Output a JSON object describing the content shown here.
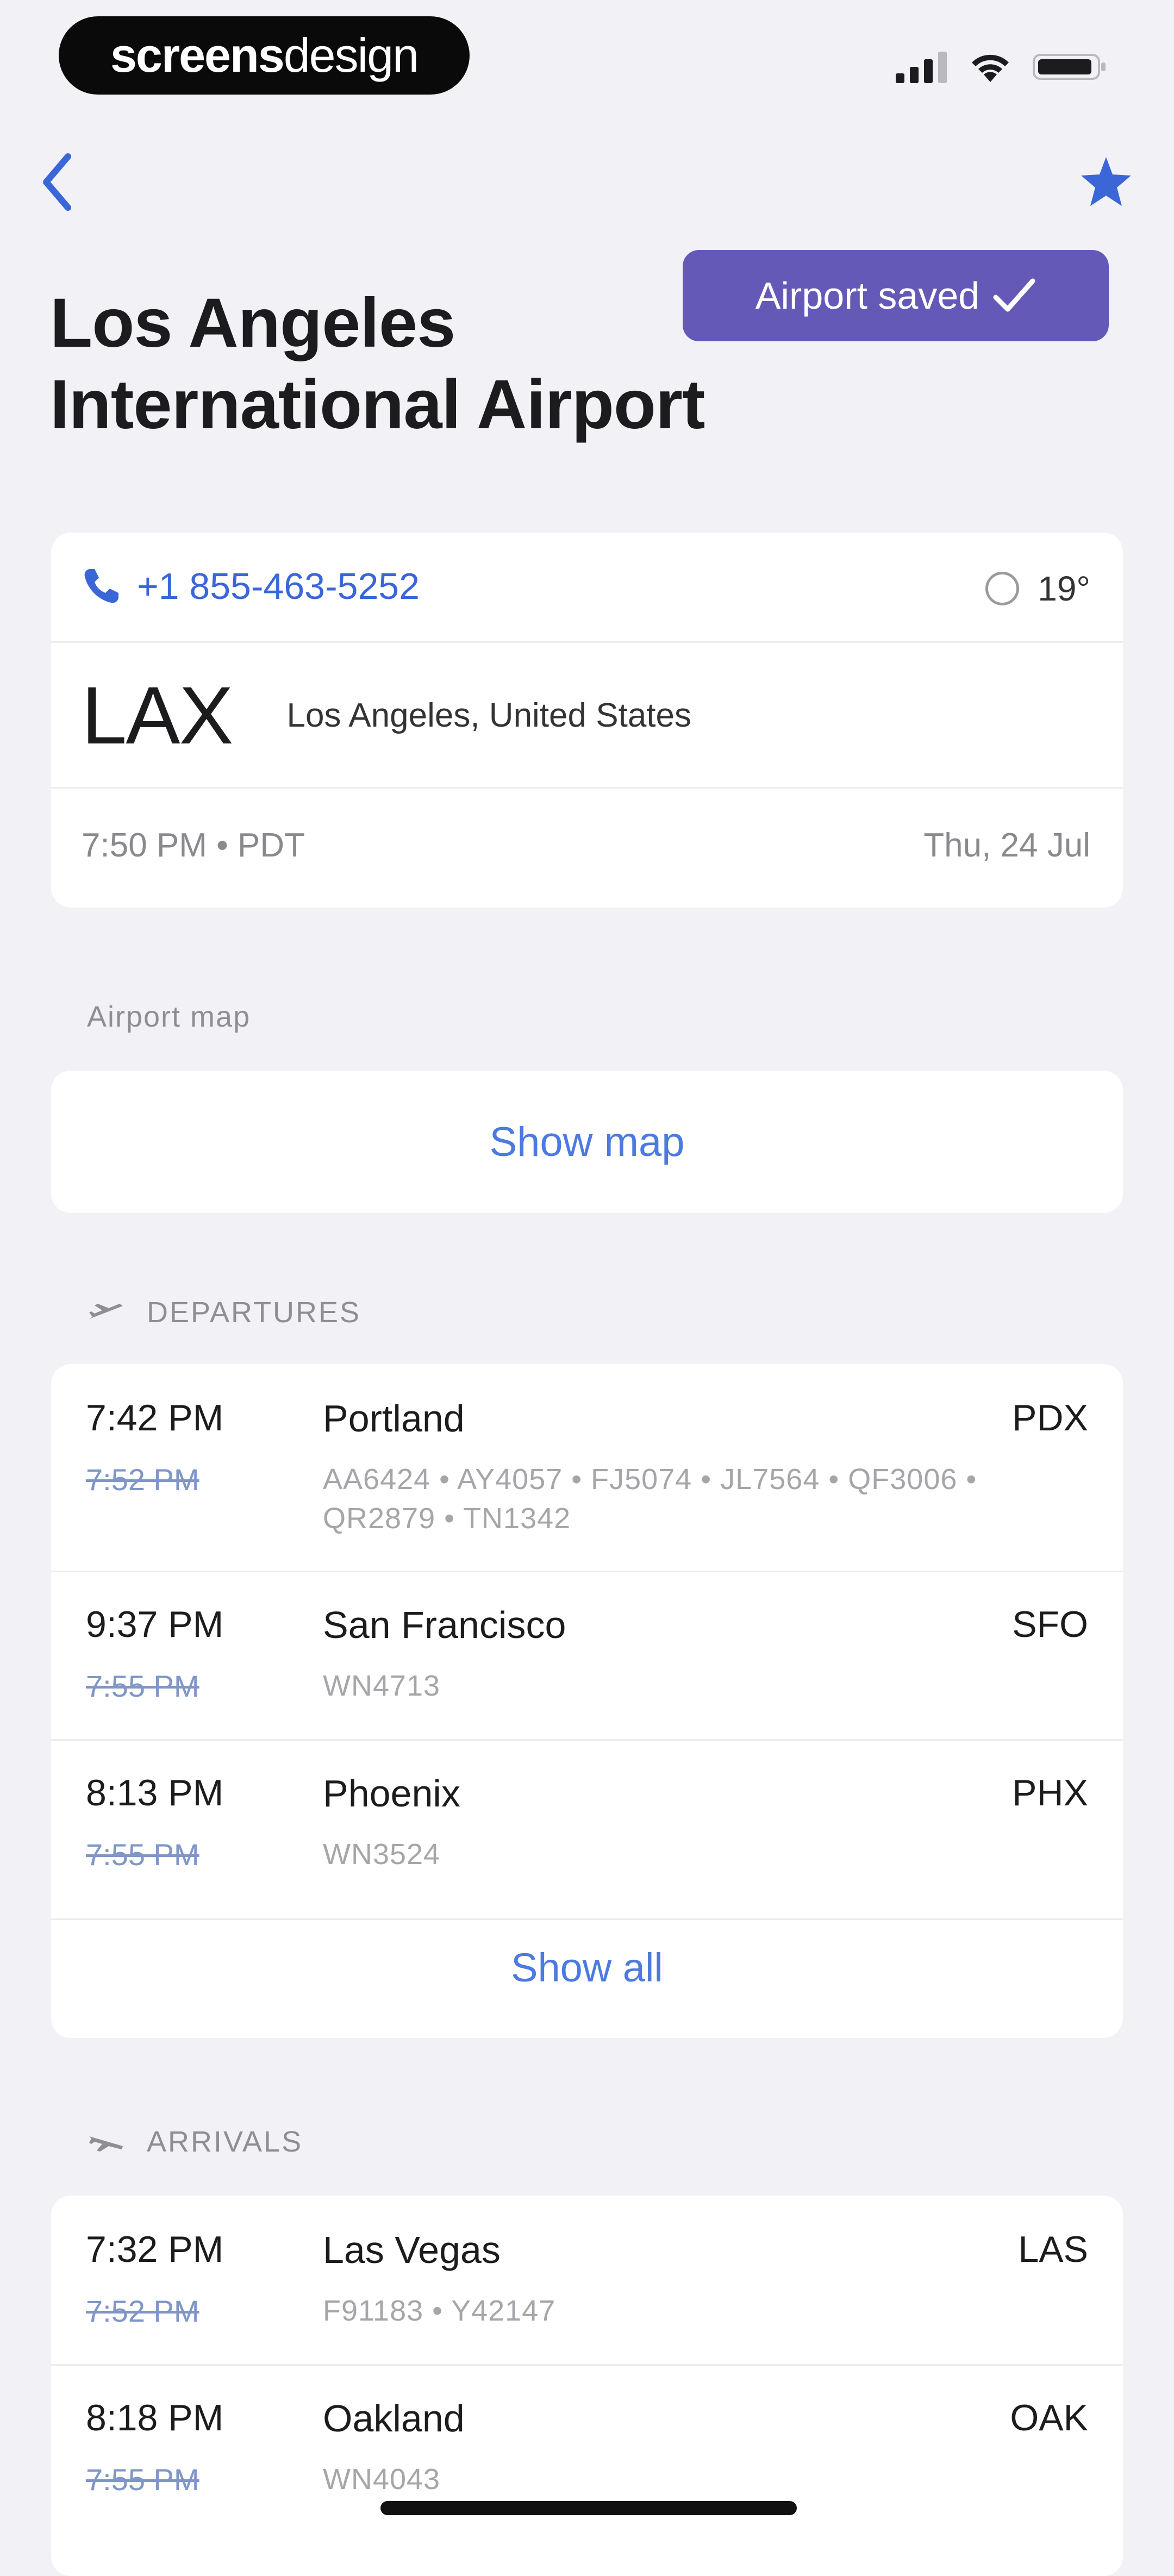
{
  "status_bar": {
    "brand_main": "screens",
    "brand_thin": "design",
    "signal_icon": "signal-bars-icon",
    "wifi_icon": "wifi-icon",
    "battery_icon": "battery-icon"
  },
  "nav": {
    "back_icon": "chevron-left-icon",
    "favorite_icon": "star-icon"
  },
  "toast": {
    "label": "Airport saved",
    "icon": "checkmark-icon"
  },
  "airport": {
    "title_line1": "Los Angeles",
    "title_line2": "International Airport",
    "phone": "+1 855-463-5252",
    "temperature": "19°",
    "code": "LAX",
    "location": "Los Angeles, United States",
    "local_time": "7:50 PM • PDT",
    "local_date": "Thu, 24 Jul"
  },
  "map": {
    "section_label": "Airport map",
    "show_label": "Show map"
  },
  "departures": {
    "section_label": "DEPARTURES",
    "icon": "plane-takeoff-icon",
    "rows": [
      {
        "time": "7:42 PM",
        "scheduled": "7:52 PM",
        "destination": "Portland",
        "flights": "AA6424 • AY4057 • FJ5074 • JL7564 • QF3006 • QR2879 • TN1342",
        "iata": "PDX"
      },
      {
        "time": "9:37 PM",
        "scheduled": "7:55 PM",
        "destination": "San Francisco",
        "flights": "WN4713",
        "iata": "SFO"
      },
      {
        "time": "8:13 PM",
        "scheduled": "7:55 PM",
        "destination": "Phoenix",
        "flights": "WN3524",
        "iata": "PHX"
      }
    ],
    "show_all": "Show all"
  },
  "arrivals": {
    "section_label": "ARRIVALS",
    "icon": "plane-landing-icon",
    "rows": [
      {
        "time": "7:32 PM",
        "scheduled": "7:52 PM",
        "origin": "Las Vegas",
        "flights": "F91183 • Y42147",
        "iata": "LAS"
      },
      {
        "time": "8:18 PM",
        "scheduled": "7:55 PM",
        "origin": "Oakland",
        "flights": "WN4043",
        "iata": "OAK"
      }
    ]
  },
  "colors": {
    "accent_blue": "#3a66d8",
    "toast_purple": "#6559b8",
    "background": "#f2f2f6"
  }
}
